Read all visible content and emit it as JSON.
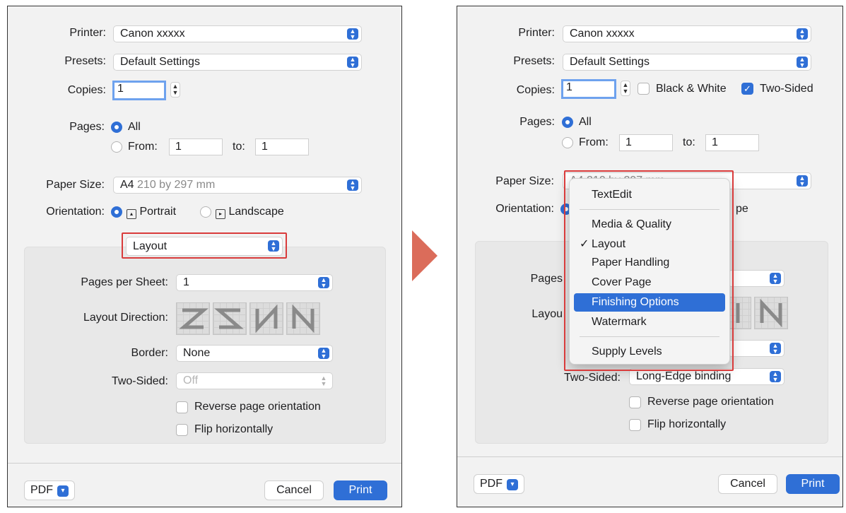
{
  "dialog": {
    "printer_label": "Printer:",
    "printer_value": "Canon xxxxx",
    "presets_label": "Presets:",
    "presets_value": "Default Settings",
    "copies_label": "Copies:",
    "copies_value": "1",
    "black_white_label": "Black & White",
    "two_sided_check_label": "Two-Sided",
    "pages_label": "Pages:",
    "all_label": "All",
    "from_label": "From:",
    "from_value": "1",
    "to_label": "to:",
    "to_value": "1",
    "paper_size_label": "Paper Size:",
    "paper_size_value": "A4",
    "paper_size_detail": "210 by 297 mm",
    "paper_size_detail_right": "A4 210 by 297 mm",
    "orientation_label": "Orientation:",
    "portrait_label": "Portrait",
    "landscape_label": "Landscape",
    "landscape_fragment": "pe",
    "section_value": "Layout",
    "pages_per_sheet_label": "Pages per Sheet:",
    "pages_per_sheet_fragment": "Pages",
    "pages_per_sheet_value": "1",
    "layout_direction_label": "Layout Direction:",
    "layout_direction_fragment": "Layou",
    "border_label": "Border:",
    "border_value": "None",
    "two_sided_label": "Two-Sided:",
    "two_sided_value_left": "Off",
    "two_sided_value_right": "Long-Edge binding",
    "reverse_label": "Reverse page orientation",
    "flip_label": "Flip horizontally",
    "pdf_label": "PDF",
    "cancel_label": "Cancel",
    "print_label": "Print"
  },
  "menu": {
    "items": [
      "TextEdit",
      "Media & Quality",
      "Layout",
      "Paper Handling",
      "Cover Page",
      "Finishing Options",
      "Watermark",
      "Supply Levels"
    ],
    "checked": "Layout",
    "selected": "Finishing Options",
    "check_glyph": "✓"
  },
  "colors": {
    "accent": "#2f6fd6",
    "highlight": "#d93b3b",
    "arrow": "#db6c5a"
  }
}
